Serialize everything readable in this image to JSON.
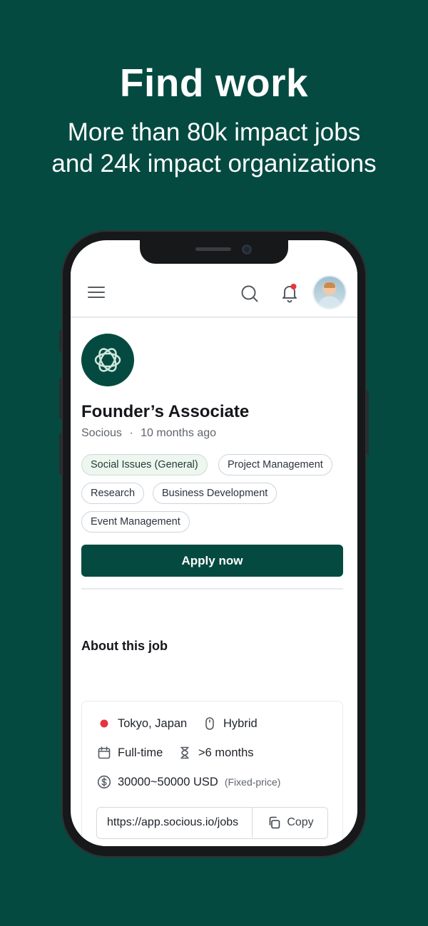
{
  "hero": {
    "title": "Find work",
    "subtitle_line1": "More than 80k impact jobs",
    "subtitle_line2": "and 24k impact organizations"
  },
  "topbar": {
    "menu_icon": "hamburger-menu-icon",
    "search_icon": "search-icon",
    "notification_icon": "bell-icon",
    "has_unread_notification": true,
    "notification_dot_color": "#e5363d"
  },
  "job": {
    "title": "Founder’s Associate",
    "organization": "Socious",
    "separator": "·",
    "posted": "10 months ago",
    "tags": [
      "Social Issues (General)",
      "Project Management",
      "Research",
      "Business Development",
      "Event Management"
    ],
    "apply_label": "Apply now",
    "about_heading": "About this job",
    "details": {
      "location": "Tokyo, Japan",
      "work_mode": "Hybrid",
      "employment_type": "Full-time",
      "duration": ">6 months",
      "payment": "30000~50000 USD",
      "payment_type": "(Fixed-price)"
    },
    "share_url": "https://app.socious.io/jobs",
    "copy_label": "Copy"
  },
  "colors": {
    "brand": "#044a40",
    "chip_highlight_bg": "#eef6f0",
    "flag_red": "#e5363d"
  }
}
